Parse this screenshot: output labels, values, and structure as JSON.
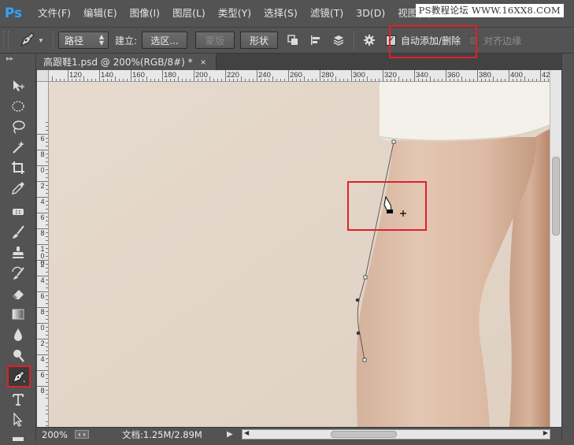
{
  "app": {
    "logo": "Ps"
  },
  "menu": [
    "文件(F)",
    "编辑(E)",
    "图像(I)",
    "图层(L)",
    "类型(Y)",
    "选择(S)",
    "滤镜(T)",
    "3D(D)",
    "视图(V)"
  ],
  "watermark": "PS教程论坛 WWW.16XX8.COM",
  "options": {
    "mode_select": "路径",
    "make_label": "建立:",
    "selection_button": "选区...",
    "mask_button": "蒙版",
    "shape_button": "形状",
    "auto_add_delete_label": "自动添加/删除",
    "auto_add_delete_checked": true,
    "align_edges_label": "对齐边缘",
    "align_edges_checked": false
  },
  "document_tab": {
    "title": "高跟鞋1.psd @ 200%(RGB/8#) *",
    "close": "×"
  },
  "ruler_h_labels": [
    "120",
    "140",
    "160",
    "180",
    "200",
    "220",
    "240",
    "260",
    "280",
    "300",
    "320",
    "340",
    "360",
    "380",
    "400",
    "42"
  ],
  "ruler_v_labels": [
    "6",
    "8",
    "0",
    "2",
    "4",
    "6",
    "8",
    "1\n0\n0",
    "2",
    "4",
    "6",
    "8",
    "0",
    "2",
    "4",
    "6",
    "8"
  ],
  "status": {
    "zoom": "200%",
    "doc_info": "文档:1.25M/2.89M"
  },
  "colors": {
    "highlight": "#e0202a",
    "canvas_bg": "#e3d6c9",
    "skin": "#dcbba5"
  }
}
